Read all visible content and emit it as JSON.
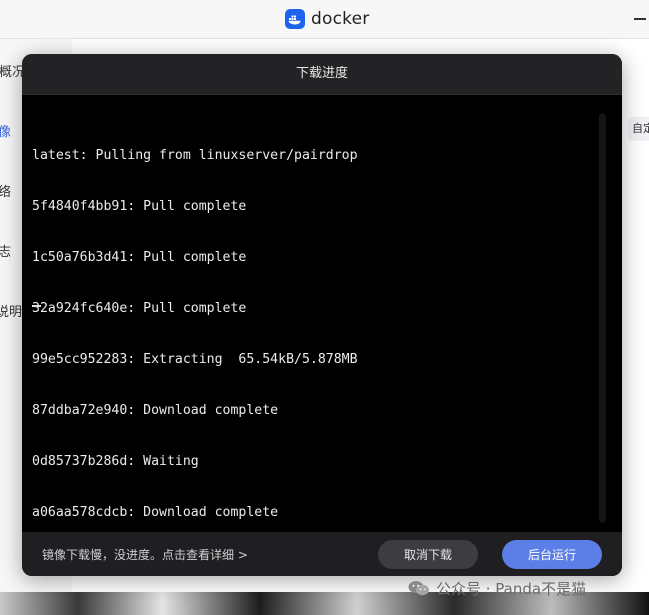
{
  "app": {
    "title": "docker",
    "icon": "docker-whale-icon",
    "accent": "#1d63ed"
  },
  "sidebar": {
    "items": [
      {
        "label": "概况"
      },
      {
        "label": "像",
        "active": true
      },
      {
        "label": "络"
      },
      {
        "label": "志"
      },
      {
        "label": "说明"
      }
    ]
  },
  "content": {
    "auto_button": "自定"
  },
  "dialog": {
    "title": "下载进度",
    "terminal_lines": [
      "latest: Pulling from linuxserver/pairdrop",
      "5f4840f4bb91: Pull complete",
      "1c50a76b3d41: Pull complete",
      "32a924fc640e: Pull complete",
      "99e5cc952283: Extracting  65.54kB/5.878MB",
      "87ddba72e940: Download complete",
      "0d85737b286d: Waiting",
      "a06aa578cdcb: Download complete"
    ],
    "footer_hint": "镜像下载慢，没进度。点击查看详细 >",
    "cancel_label": "取消下载",
    "background_label": "后台运行",
    "primary_color": "#5b7fe6"
  },
  "watermark": {
    "text": "公众号 · Panda不是猫",
    "icon": "wechat-icon"
  }
}
